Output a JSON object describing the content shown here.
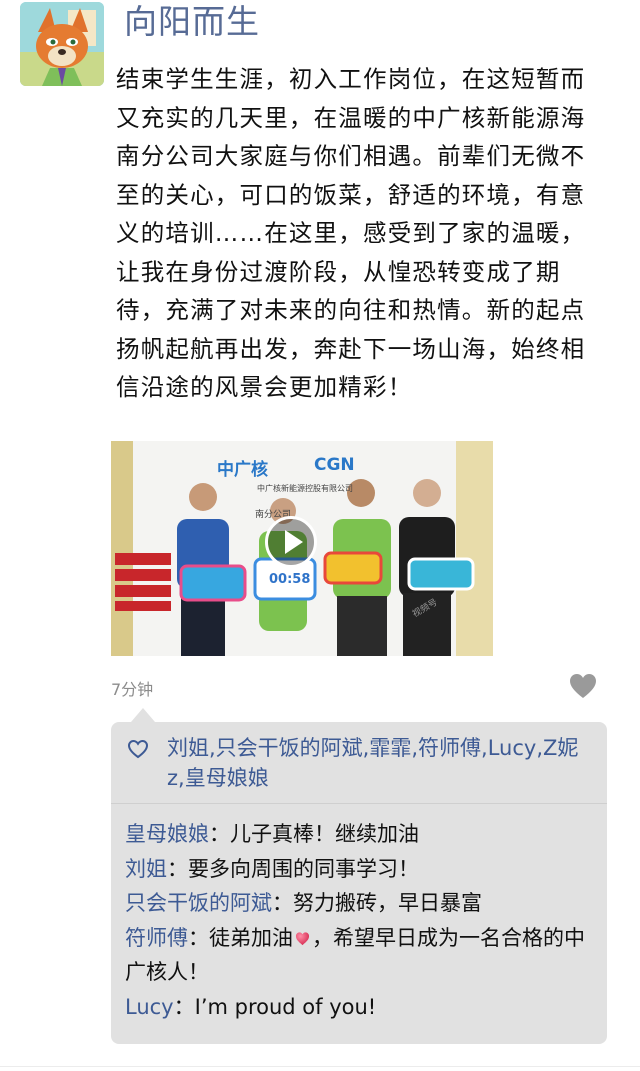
{
  "post": {
    "username": "向阳而生",
    "text": "结束学生生涯，初入工作岗位，在这短暂而又充实的几天里，在温暖的中广核新能源海南分公司大家庭与你们相遇。前辈们无微不至的关心，可口的饭菜，舒适的环境，有意义的培训……在这里，感受到了家的温暖，让我在身份过渡阶段，从惶恐转变成了期待，充满了对未来的向往和热情。新的起点扬帆起航再出发，奔赴下一场山海，始终相信沿途的风景会更加精彩！",
    "time": "7分钟"
  },
  "video": {
    "logo_cn": "中广核",
    "logo_en": "CGN",
    "company_line": "中广核新能源控股有限公司",
    "branch_line": "南分公司",
    "duration": "00:58",
    "watermark": "视频号"
  },
  "likes": {
    "names": "刘姐,只会干饭的阿斌,霏霏,符师傅,Lucy,Z妮z,皇母娘娘"
  },
  "comments": [
    {
      "author": "皇母娘娘",
      "sep": "：",
      "text": "儿子真棒！继续加油"
    },
    {
      "author": "刘姐",
      "sep": "：",
      "text": "要多向周围的同事学习！"
    },
    {
      "author": "只会干饭的阿斌",
      "sep": "：",
      "text": "努力搬砖，早日暴富"
    },
    {
      "author": "符师傅",
      "sep": "：",
      "text_before": "徒弟加油",
      "emoji": "heart-emoji",
      "text_after": "，希望早日成为一名合格的中广核人！"
    },
    {
      "author": "Lucy",
      "sep": "：",
      "text": "I’m proud of you!"
    }
  ],
  "colors": {
    "link_blue": "#576b95",
    "comment_bg": "#e1e1e1",
    "author_blue": "#3d5a94"
  }
}
